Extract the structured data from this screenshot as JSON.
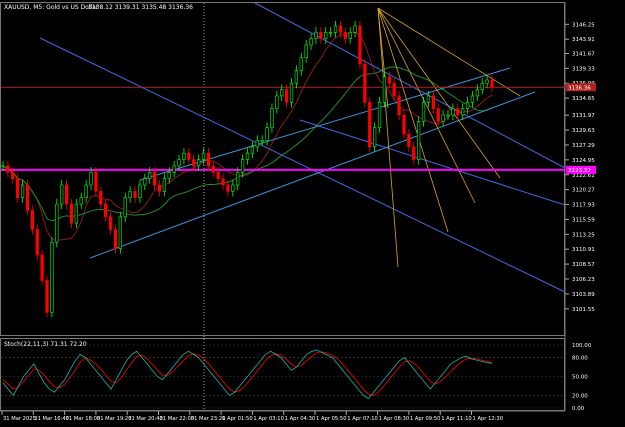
{
  "header": {
    "title": "XAUUSD, M5:  Gold vs US Dollar",
    "ohlc": "3138.12 3139.31 3135.48 3136.36"
  },
  "sub": {
    "title": "Stoch(22,11,3) 71.31 72.20"
  },
  "colors": {
    "background": "#000000",
    "bull": "#00ff00",
    "bear": "#ff0000",
    "hline_red": "#b22222",
    "hline_magenta": "#ff00ff",
    "channel_blue": "#4169e1",
    "channel_light": "#3a8fd6",
    "fan": "#daa520",
    "ma_red": "#8b1a1a",
    "ma_green": "#228b22",
    "stoch_main": "#20b2aa",
    "stoch_signal": "#ff0000"
  },
  "chart_data": {
    "type": "candlestick",
    "symbol": "XAUUSD",
    "timeframe": "M5",
    "title": "XAUUSD, M5:  Gold vs US Dollar",
    "ylim": [
      3099.0,
      3148.5
    ],
    "price_ticks": [
      3146.25,
      3143.91,
      3141.67,
      3139.33,
      3136.99,
      3134.65,
      3131.97,
      3129.63,
      3127.29,
      3124.95,
      3122.61,
      3120.27,
      3117.93,
      3115.59,
      3113.25,
      3110.91,
      3108.57,
      3106.23,
      3103.89,
      3101.55
    ],
    "time_ticks": [
      "31 Mar 2025",
      "31 Mar 16:40",
      "31 Mar 18:00",
      "31 Mar 19:20",
      "31 Mar 20:40",
      "31 Mar 22:00",
      "31 Mar 23:20",
      "1 Apr 01:50",
      "1 Apr 03:10",
      "1 Apr 04:30",
      "1 Apr 05:50",
      "1 Apr 07:10",
      "1 Apr 08:30",
      "1 Apr 09:50",
      "1 Apr 11:10",
      "1 Apr 12:30"
    ],
    "closes": [
      3124,
      3123,
      3122,
      3119,
      3121,
      3117,
      3114,
      3110,
      3106,
      3101,
      3112,
      3118,
      3121,
      3118,
      3115,
      3118,
      3119,
      3121,
      3123,
      3120,
      3118,
      3116,
      3114,
      3111,
      3116,
      3119,
      3120,
      3119,
      3121,
      3122,
      3123,
      3121,
      3120,
      3122,
      3123,
      3124,
      3125,
      3126,
      3125,
      3124,
      3125,
      3126,
      3124,
      3123,
      3122,
      3121,
      3120,
      3121,
      3123,
      3125,
      3126,
      3127,
      3128,
      3128,
      3130,
      3133,
      3135,
      3136,
      3134,
      3137,
      3139,
      3141,
      3143,
      3144,
      3145,
      3144,
      3145,
      3145,
      3146,
      3145,
      3144,
      3145,
      3146,
      3140,
      3134,
      3127,
      3130,
      3134,
      3138,
      3137,
      3135,
      3132,
      3129,
      3127,
      3125,
      3131,
      3134,
      3135,
      3133,
      3131,
      3132,
      3132,
      3133,
      3132,
      3133,
      3134,
      3135,
      3136,
      3137,
      3137.5,
      3136.4
    ],
    "hlines": [
      {
        "price": "3136.36"
      },
      {
        "price": "3123.37"
      }
    ],
    "osc_levels": [
      "100.00",
      "80.00",
      "50.00",
      "20.00",
      "0.00"
    ],
    "stoch_main": [
      40,
      30,
      20,
      35,
      50,
      60,
      70,
      55,
      40,
      30,
      25,
      35,
      45,
      60,
      75,
      85,
      80,
      70,
      60,
      50,
      40,
      30,
      45,
      60,
      75,
      85,
      90,
      80,
      70,
      60,
      50,
      45,
      55,
      65,
      75,
      85,
      90,
      85,
      80,
      70,
      60,
      50,
      40,
      30,
      20,
      25,
      35,
      45,
      55,
      65,
      75,
      85,
      90,
      85,
      80,
      70,
      60,
      65,
      75,
      85,
      90,
      92,
      88,
      84,
      80,
      70,
      60,
      50,
      40,
      30,
      20,
      15,
      25,
      35,
      45,
      55,
      65,
      75,
      80,
      70,
      60,
      50,
      40,
      30,
      40,
      50,
      60,
      70,
      75,
      80,
      82,
      78,
      76,
      74,
      72,
      71
    ],
    "stoch_signal": [
      45,
      38,
      30,
      33,
      42,
      52,
      62,
      60,
      52,
      42,
      34,
      32,
      38,
      48,
      60,
      72,
      80,
      76,
      70,
      62,
      52,
      42,
      40,
      48,
      60,
      72,
      82,
      84,
      78,
      70,
      60,
      52,
      52,
      58,
      66,
      75,
      83,
      86,
      84,
      78,
      70,
      60,
      50,
      40,
      30,
      25,
      28,
      35,
      45,
      55,
      65,
      75,
      83,
      86,
      84,
      78,
      70,
      65,
      68,
      75,
      82,
      88,
      89,
      87,
      84,
      78,
      70,
      60,
      50,
      40,
      30,
      22,
      20,
      26,
      35,
      45,
      55,
      65,
      73,
      75,
      70,
      62,
      52,
      42,
      38,
      42,
      50,
      58,
      66,
      73,
      78,
      79,
      78,
      76,
      74,
      72
    ]
  }
}
